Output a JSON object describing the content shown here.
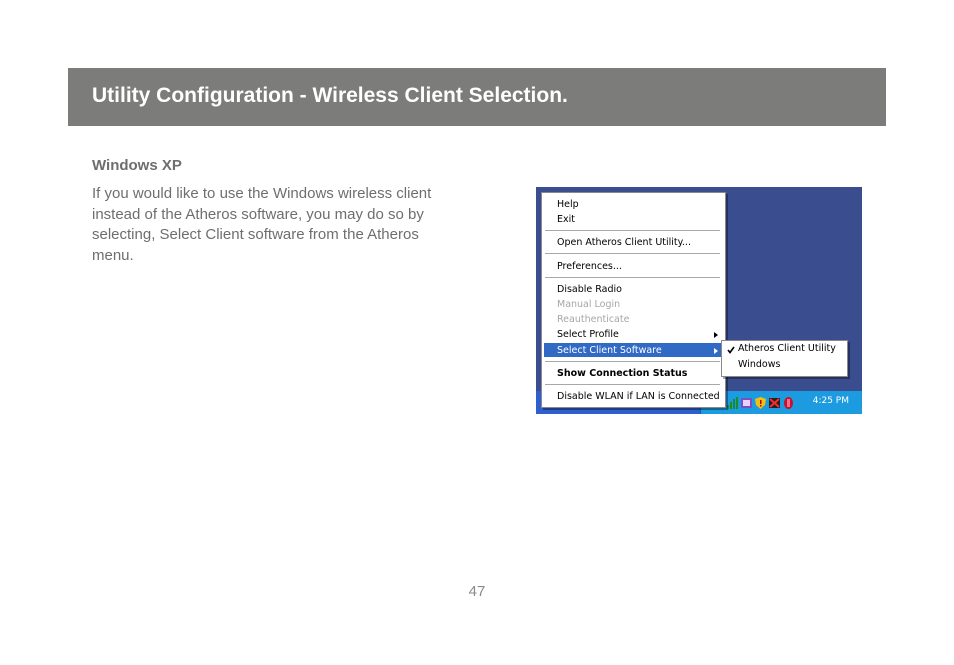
{
  "header": {
    "title": "Utility Configuration - Wireless Client Selection."
  },
  "section": {
    "heading": "Windows XP",
    "paragraph": "If you would like to use the Windows wireless client instead of the Atheros software, you may do so by selecting, Select Client software from the Atheros menu."
  },
  "screenshot": {
    "menu": {
      "help": "Help",
      "exit": "Exit",
      "open_utility": "Open Atheros Client Utility...",
      "preferences": "Preferences...",
      "disable_radio": "Disable Radio",
      "manual_login": "Manual Login",
      "reauthenticate": "Reauthenticate",
      "select_profile": "Select Profile",
      "select_client_software": "Select Client Software",
      "show_connection_status": "Show Connection Status",
      "disable_wlan": "Disable WLAN if LAN is Connected"
    },
    "submenu": {
      "atheros": "Atheros Client Utility",
      "windows": "Windows",
      "checked_item": "Atheros Client Utility"
    },
    "clock": "4:25 PM",
    "colors": {
      "highlight": "#316ac5",
      "desktop": "#3a4d8f",
      "tray": "#1d9be0"
    }
  },
  "footer": {
    "page_number": "47"
  }
}
